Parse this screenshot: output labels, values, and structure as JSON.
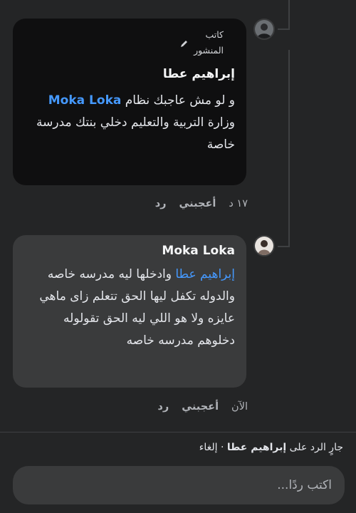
{
  "comment1": {
    "badge_line1": "كاتب",
    "badge_line2": "المنشور",
    "author": "إبراهيم عطا",
    "text_before_mention": "و لو مش عاجبك نظام ",
    "mention": "Moka Loka",
    "text_after_mention": " وزارة التربية والتعليم دخلي بنتك مدرسة خاصة",
    "time": "١٧ د",
    "like_label": "أعجبني",
    "reply_label": "رد"
  },
  "comment2": {
    "author": "Moka Loka",
    "mention": "إبراهيم عطا",
    "text_after_mention": " وادخلها ليه مدرسه خاصه والدوله تكفل ليها الحق تتعلم زاى ماهي عايزه ولا هو اللي ليه الحق تقولوله دخلوهم مدرسه خاصه",
    "time": "الآن",
    "like_label": "أعجبني",
    "reply_label": "رد"
  },
  "reply_bar": {
    "prefix": "جارٍ الرد على ",
    "name": "إبراهيم عطا",
    "separator": " · ",
    "cancel": "إلغاء"
  },
  "composer": {
    "placeholder": "اكتب ردًا..."
  }
}
